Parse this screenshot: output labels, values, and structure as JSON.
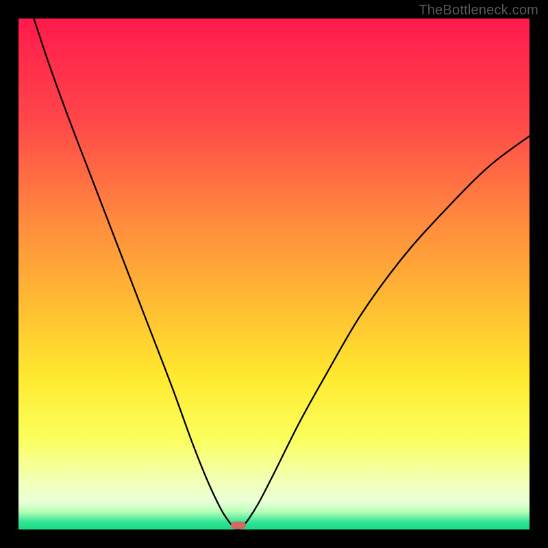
{
  "watermark": "TheBottleneck.com",
  "chart_data": {
    "type": "line",
    "title": "",
    "xlabel": "",
    "ylabel": "",
    "xlim": [
      0,
      100
    ],
    "ylim": [
      0,
      100
    ],
    "series": [
      {
        "name": "bottleneck-curve",
        "x": [
          3,
          6,
          10,
          15,
          20,
          25,
          30,
          34,
          37,
          39.5,
          41,
          42,
          42.8,
          43.0,
          43.8,
          45,
          47,
          50,
          55,
          60,
          67,
          75,
          83,
          92,
          100
        ],
        "y": [
          100,
          91,
          80,
          67,
          54,
          41,
          28,
          17,
          9.5,
          4.2,
          1.8,
          0.6,
          0.05,
          0.05,
          0.6,
          2.0,
          5.2,
          11,
          21,
          30,
          42,
          53,
          62,
          71,
          77
        ]
      }
    ],
    "gradient_stops": [
      {
        "offset": 0,
        "color": "#ff1a4b"
      },
      {
        "offset": 0.2,
        "color": "#ff474a"
      },
      {
        "offset": 0.4,
        "color": "#ff8c3e"
      },
      {
        "offset": 0.55,
        "color": "#ffb933"
      },
      {
        "offset": 0.7,
        "color": "#ffe92e"
      },
      {
        "offset": 0.82,
        "color": "#fbff5c"
      },
      {
        "offset": 0.9,
        "color": "#f3ffb0"
      },
      {
        "offset": 0.945,
        "color": "#eaffd8"
      },
      {
        "offset": 0.965,
        "color": "#b8ffb8"
      },
      {
        "offset": 0.985,
        "color": "#34e597"
      },
      {
        "offset": 1.0,
        "color": "#19d883"
      }
    ],
    "marker": {
      "x": 43.0,
      "y": 0.8,
      "color": "#cf6a62"
    },
    "curve_stroke": "#000000",
    "curve_width": 2.3
  }
}
